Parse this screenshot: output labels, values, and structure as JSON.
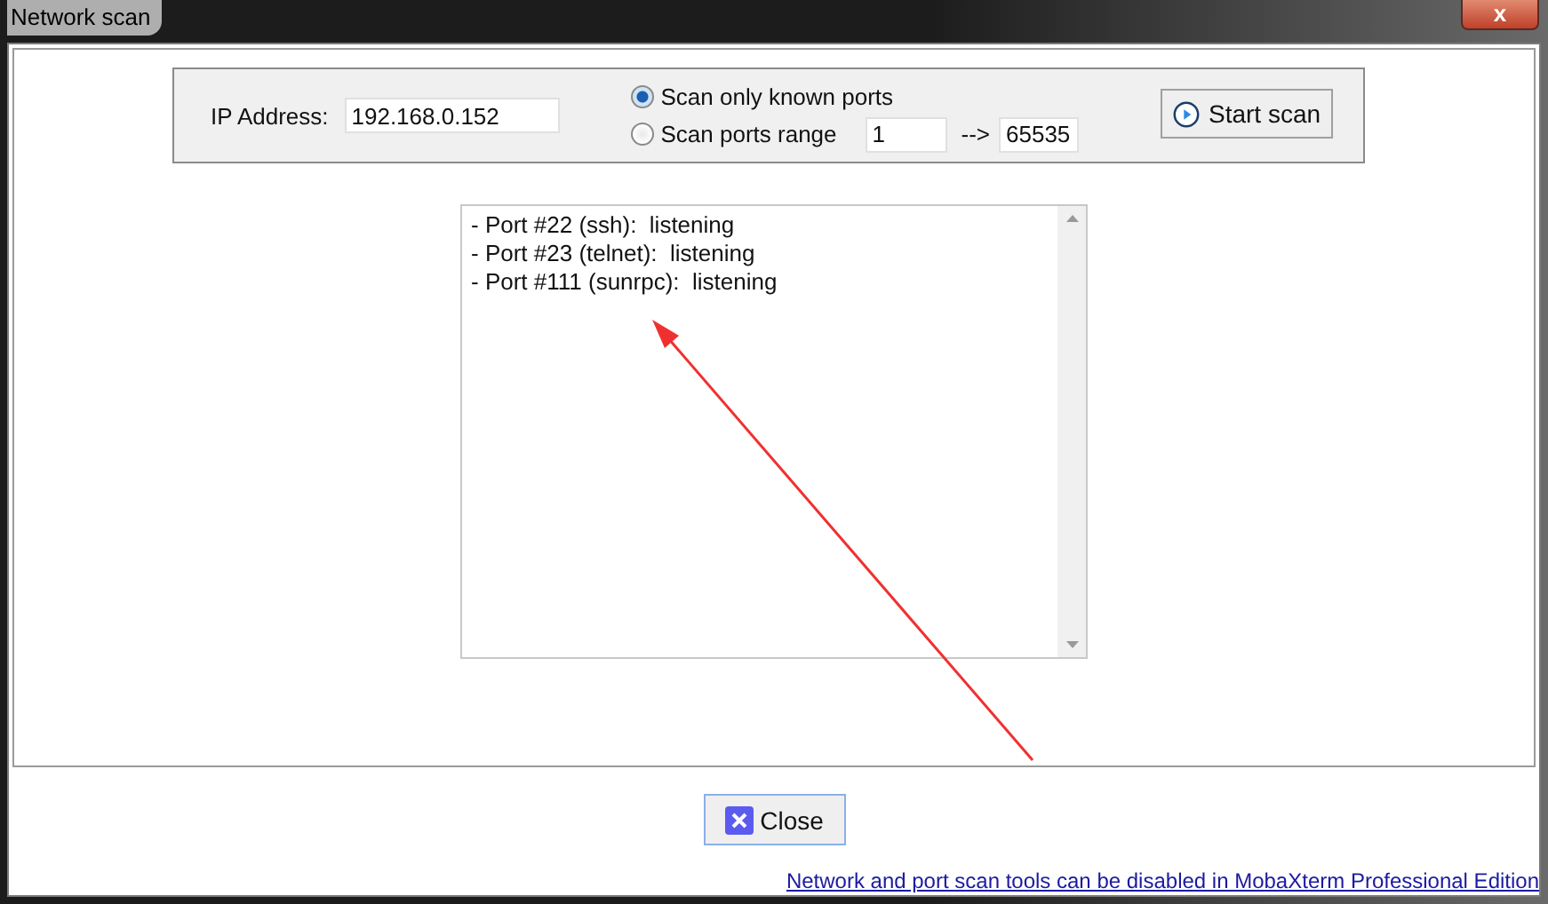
{
  "window": {
    "title": "Network scan",
    "close_glyph": "x"
  },
  "scan_form": {
    "ip_label": "IP Address:",
    "ip_value": "192.168.0.152",
    "modes": [
      {
        "label": "Scan only known ports",
        "selected": true
      },
      {
        "label": "Scan ports range",
        "selected": false
      }
    ],
    "range_from": "1",
    "range_arrow": "-->",
    "range_to": "65535",
    "start_button": "Start scan"
  },
  "results": [
    "- Port #22 (ssh):  listening",
    "- Port #23 (telnet):  listening",
    "- Port #111 (sunrpc):  listening"
  ],
  "close_button": "Close",
  "footer_link": "Network and port scan tools can be disabled in MobaXterm Professional Edition"
}
